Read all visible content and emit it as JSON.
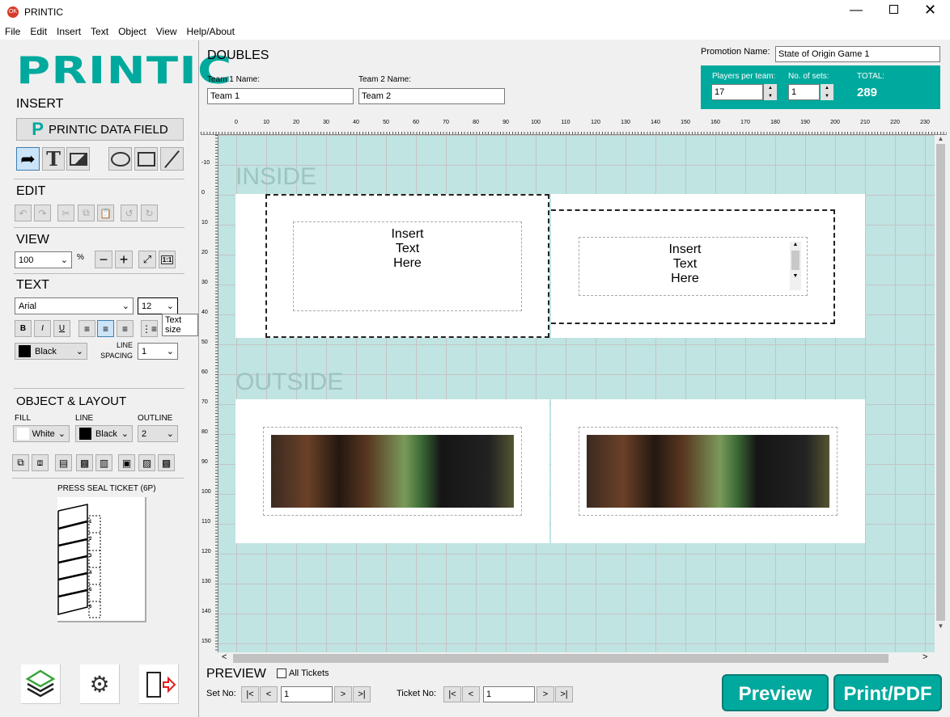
{
  "window": {
    "title": "PRINTIC",
    "icon": "printic-app-icon",
    "controls": [
      "minimize",
      "maximize",
      "close"
    ]
  },
  "menu": [
    "File",
    "Edit",
    "Insert",
    "Text",
    "Object",
    "View",
    "Help/About"
  ],
  "sidebar": {
    "logo": "PRINTIC",
    "insert": {
      "title": "INSERT",
      "data_field_button": "PRINTIC DATA FIELD",
      "tools": [
        "select-arrow",
        "text-tool",
        "image-tool",
        "ellipse-tool",
        "rectangle-tool",
        "line-tool"
      ]
    },
    "edit": {
      "title": "EDIT",
      "tools": [
        "undo",
        "redo",
        "cut",
        "copy",
        "paste",
        "rotate-left",
        "rotate-right"
      ]
    },
    "view": {
      "title": "VIEW",
      "zoom": "100",
      "percent": "%",
      "tools": [
        "zoom-out",
        "zoom-in",
        "fit",
        "actual-size"
      ],
      "actual_size_label": "1:1"
    },
    "text": {
      "title": "TEXT",
      "font": "Arial",
      "size": "12",
      "tooltip": "Text size",
      "bold": "B",
      "italic": "I",
      "underline": "U",
      "align_selected": "center",
      "color": "Black",
      "color_hex": "#000000",
      "line_spacing_label": "LINE\nSPACING",
      "line_spacing": "1"
    },
    "object": {
      "title": "OBJECT & LAYOUT",
      "fill_label": "FILL",
      "fill": "White",
      "fill_hex": "#ffffff",
      "line_label": "LINE",
      "line": "Black",
      "line_hex": "#000000",
      "outline_label": "OUTLINE",
      "outline": "2"
    },
    "ticket": {
      "title": "PRESS SEAL TICKET (6P)",
      "panels": [
        "1",
        "2",
        "3",
        "4",
        "5",
        "6"
      ]
    },
    "bottom_buttons": [
      "layers",
      "settings",
      "exit"
    ]
  },
  "header": {
    "title": "DOUBLES",
    "team1_label": "Team 1 Name:",
    "team1": "Team 1",
    "team2_label": "Team 2 Name:",
    "team2": "Team 2",
    "promo_label": "Promotion Name:",
    "promo": "State of Origin Game 1",
    "players_label": "Players per team:",
    "players": "17",
    "sets_label": "No. of sets:",
    "sets": "1",
    "total_label": "TOTAL:",
    "total": "289",
    "accent": "#00a99d"
  },
  "rulers": {
    "top": [
      "0",
      "10",
      "20",
      "30",
      "40",
      "50",
      "60",
      "70",
      "80",
      "90",
      "100",
      "110",
      "120",
      "130",
      "140",
      "150",
      "160",
      "170",
      "180",
      "190",
      "200",
      "210",
      "220",
      "230"
    ],
    "left": [
      "-10",
      "0",
      "10",
      "20",
      "30",
      "40",
      "50",
      "60",
      "70",
      "80",
      "90",
      "100",
      "110",
      "120",
      "130",
      "140",
      "150"
    ]
  },
  "canvas": {
    "inside_label": "INSIDE",
    "outside_label": "OUTSIDE",
    "text1": "Insert\nText\nHere",
    "text2": "Insert\nText\nHere"
  },
  "preview": {
    "title": "PREVIEW",
    "all_tickets": "All Tickets",
    "set_label": "Set No:",
    "set": "1",
    "ticket_label": "Ticket No:",
    "ticket": "1",
    "first": "|<",
    "prev": "<",
    "next": ">",
    "last": ">|",
    "preview_button": "Preview",
    "print_button": "Print/PDF"
  }
}
